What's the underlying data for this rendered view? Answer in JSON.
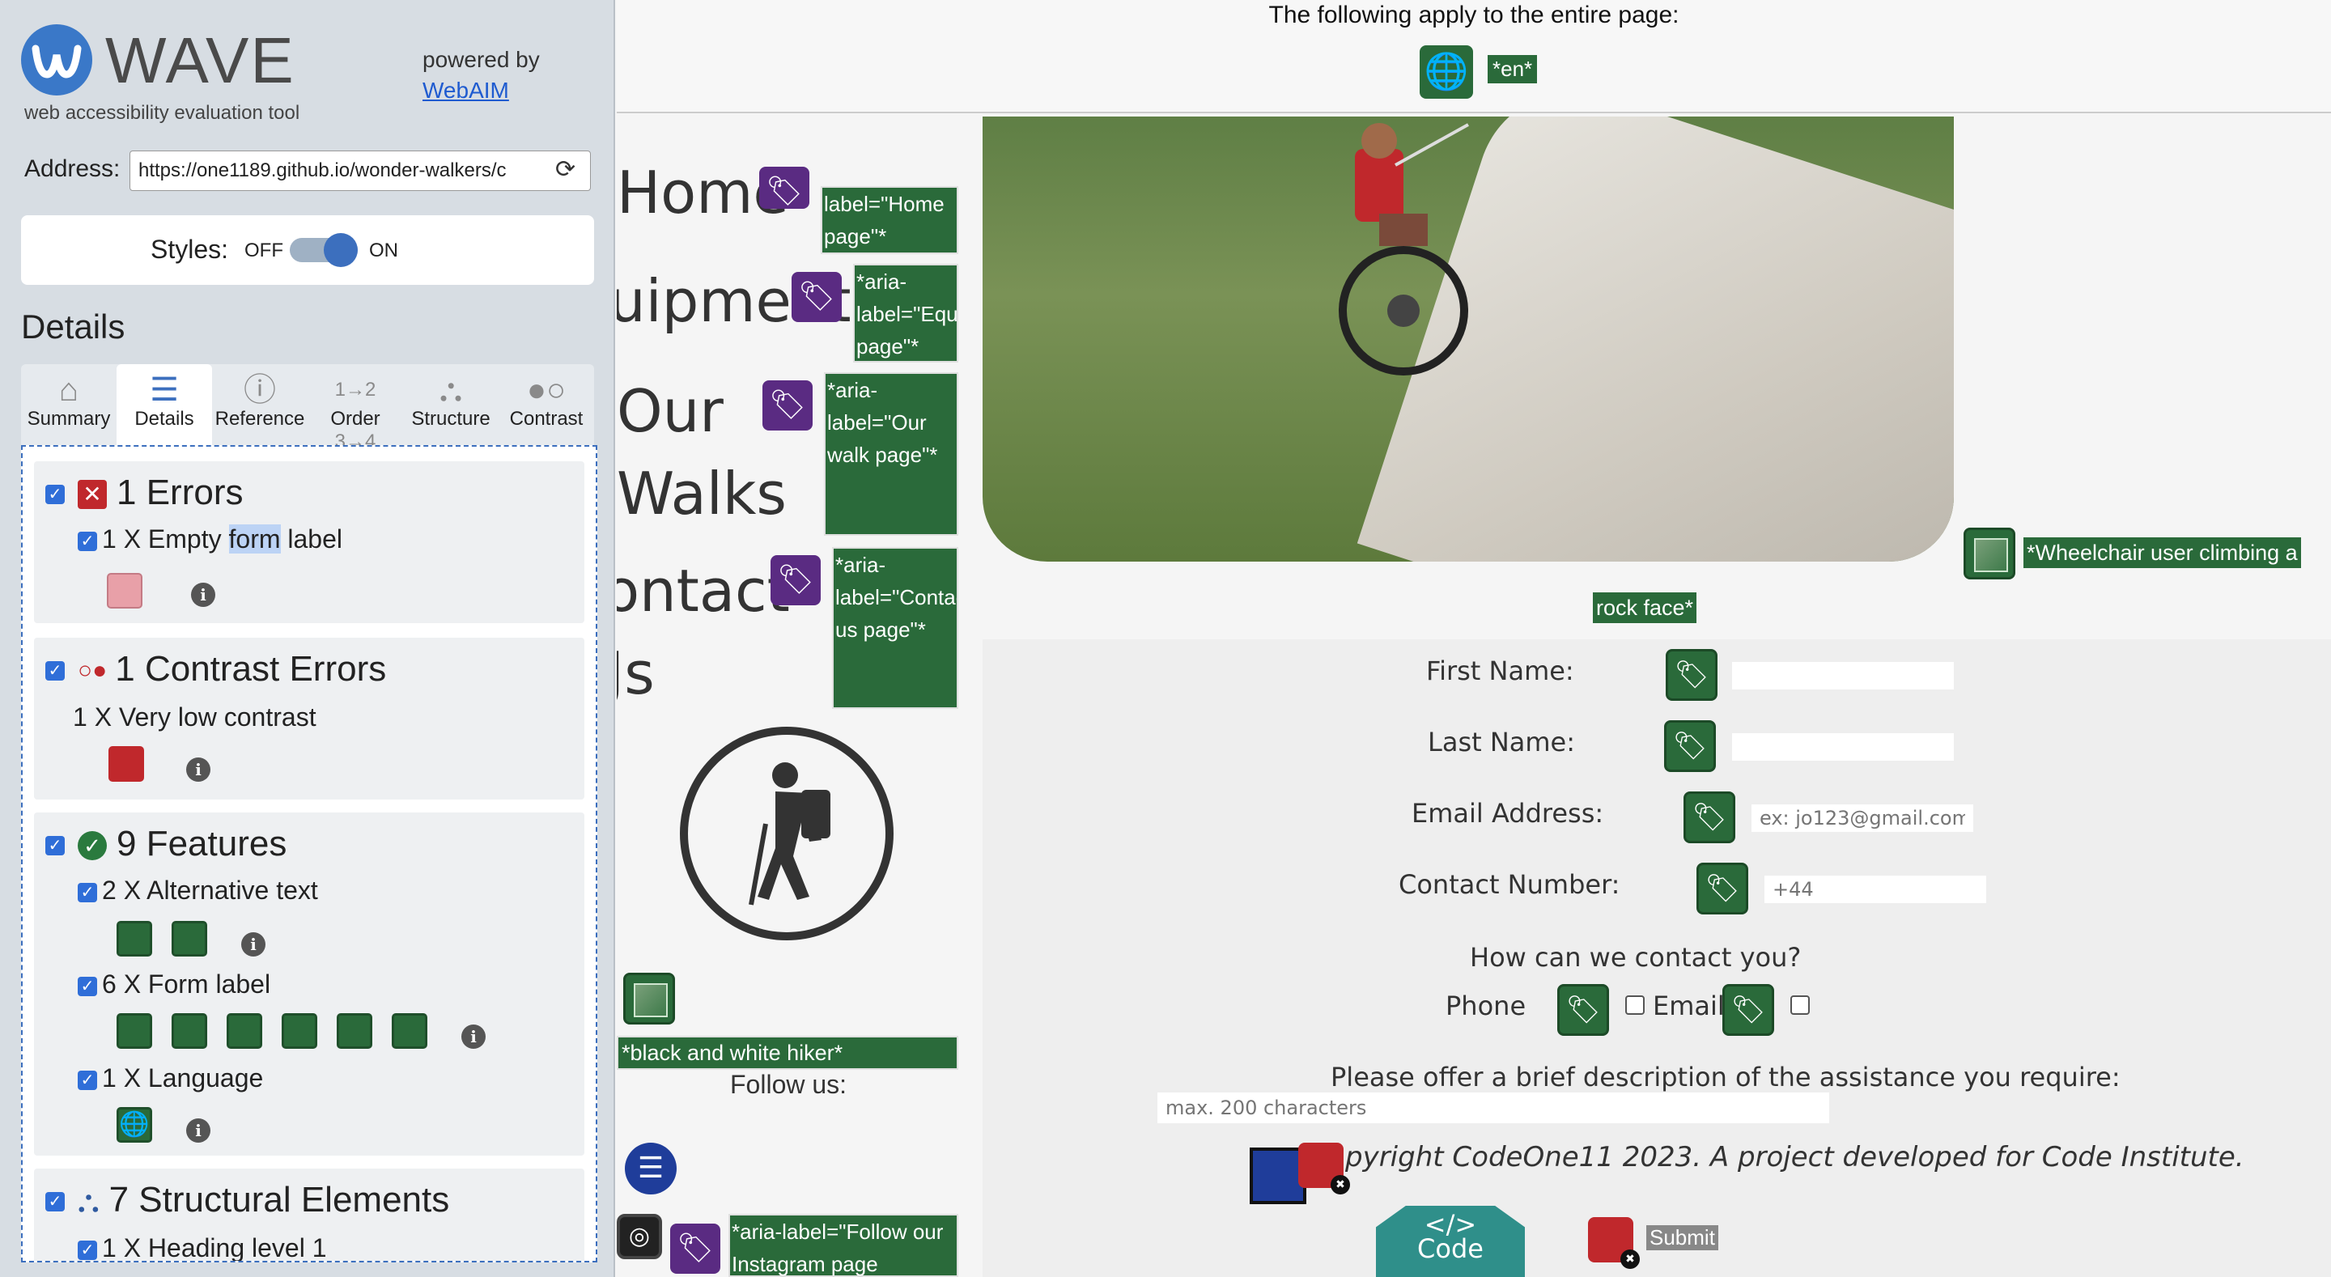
{
  "wave": {
    "logo_text": "WAVE",
    "tagline": "web accessibility evaluation tool",
    "powered_by": "powered by",
    "powered_link": "WebAIM",
    "address_label": "Address:",
    "address_value": "https://one1189.github.io/wonder-walkers/c",
    "styles_label": "Styles:",
    "styles_off": "OFF",
    "styles_on": "ON",
    "details_heading": "Details",
    "tabs": [
      {
        "label": "Summary",
        "icon": "home-icon"
      },
      {
        "label": "Details",
        "icon": "list-icon"
      },
      {
        "label": "Reference",
        "icon": "info-icon"
      },
      {
        "label": "Order",
        "icon": "order-icon"
      },
      {
        "label": "Structure",
        "icon": "structure-icon"
      },
      {
        "label": "Contrast",
        "icon": "contrast-icon"
      }
    ],
    "groups": {
      "errors": {
        "title": "1 Errors",
        "items": [
          {
            "pre": "1 X Empty ",
            "hl": "form",
            "post": " label"
          }
        ]
      },
      "contrast": {
        "title": "1 Contrast Errors",
        "items": [
          "1 X Very low contrast"
        ]
      },
      "features": {
        "title": "9 Features",
        "items": [
          "2 X Alternative text",
          "6 X Form label",
          "1 X Language"
        ]
      },
      "structure": {
        "title": "7 Structural Elements",
        "items": [
          "1 X Heading level 1"
        ]
      }
    }
  },
  "page": {
    "notice": "The following apply to the entire page:",
    "lang_badge": "*en*",
    "nav": [
      {
        "text": "Home",
        "label": "label=\"Home page\"*"
      },
      {
        "text": "uipment",
        "label": "*aria-label=\"Equ page\"*"
      },
      {
        "text": "Our",
        "label": "*aria-label=\"Our walk page\"*"
      },
      {
        "text": "Walks",
        "label": ""
      },
      {
        "text": "ontact",
        "label": "*aria-label=\"Contact us page\"*"
      },
      {
        "text": "Js",
        "label": ""
      }
    ],
    "hero_alt": "*Wheelchair user climbing a",
    "hero_alt_2": "rock face*",
    "hiker_alt": "*black and white hiker*",
    "follow_us": "Follow us:",
    "instagram_label": "*aria-label=\"Follow our Instagram page",
    "form": {
      "first_name": "First Name:",
      "last_name": "Last Name:",
      "email": "Email Address:",
      "email_placeholder": "ex: jo123@gmail.com",
      "contact_number": "Contact Number:",
      "contact_placeholder": "+44",
      "contact_question": "How can we contact you?",
      "phone": "Phone",
      "email_option": "Email",
      "description_label": "Please offer a brief description of the assistance you require:",
      "description_placeholder": "max. 200 characters",
      "submit": "Submit"
    },
    "copyright": "pyright CodeOne11 2023. A project developed for Code Institute.",
    "code_badge": "Code",
    "code_symbol": "</>"
  },
  "colors": {
    "wave_blue": "#3c6fbe",
    "feature_green": "#2a6a3a",
    "aria_purple": "#5a2b82",
    "error_red": "#c0282c"
  }
}
